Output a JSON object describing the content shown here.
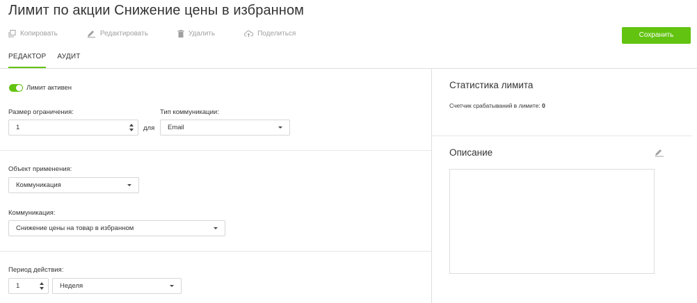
{
  "header": {
    "title": "Лимит по акции Снижение цены в избранном"
  },
  "toolbar": {
    "copy_label": "Копировать",
    "edit_label": "Редактировать",
    "delete_label": "Удалить",
    "share_label": "Поделиться",
    "save_label": "Сохранить"
  },
  "tabs": [
    {
      "label": "РЕДАКТОР",
      "active": true
    },
    {
      "label": "АУДИТ",
      "active": false
    }
  ],
  "editor": {
    "active_toggle": {
      "label": "Лимит активен",
      "on": true
    },
    "limit_size": {
      "label": "Размер ограничения:",
      "value": "1"
    },
    "for_label": "для",
    "comm_type": {
      "label": "Тип коммуникации:",
      "value": "Email"
    },
    "object": {
      "label": "Объект применения:",
      "value": "Коммуникация"
    },
    "communication": {
      "label": "Коммуникация:",
      "value": "Снижение цены на товар в избранном"
    },
    "period": {
      "label": "Период действия:",
      "value": "1",
      "unit": "Неделя"
    }
  },
  "stats": {
    "title": "Статистика лимита",
    "counter_label": "Счетчик срабатываний в лимите:",
    "counter_value": "0"
  },
  "description": {
    "title": "Описание",
    "text": ""
  },
  "colors": {
    "accent": "#62c310",
    "border": "#d6d6d6",
    "muted": "#a0a0a0"
  }
}
